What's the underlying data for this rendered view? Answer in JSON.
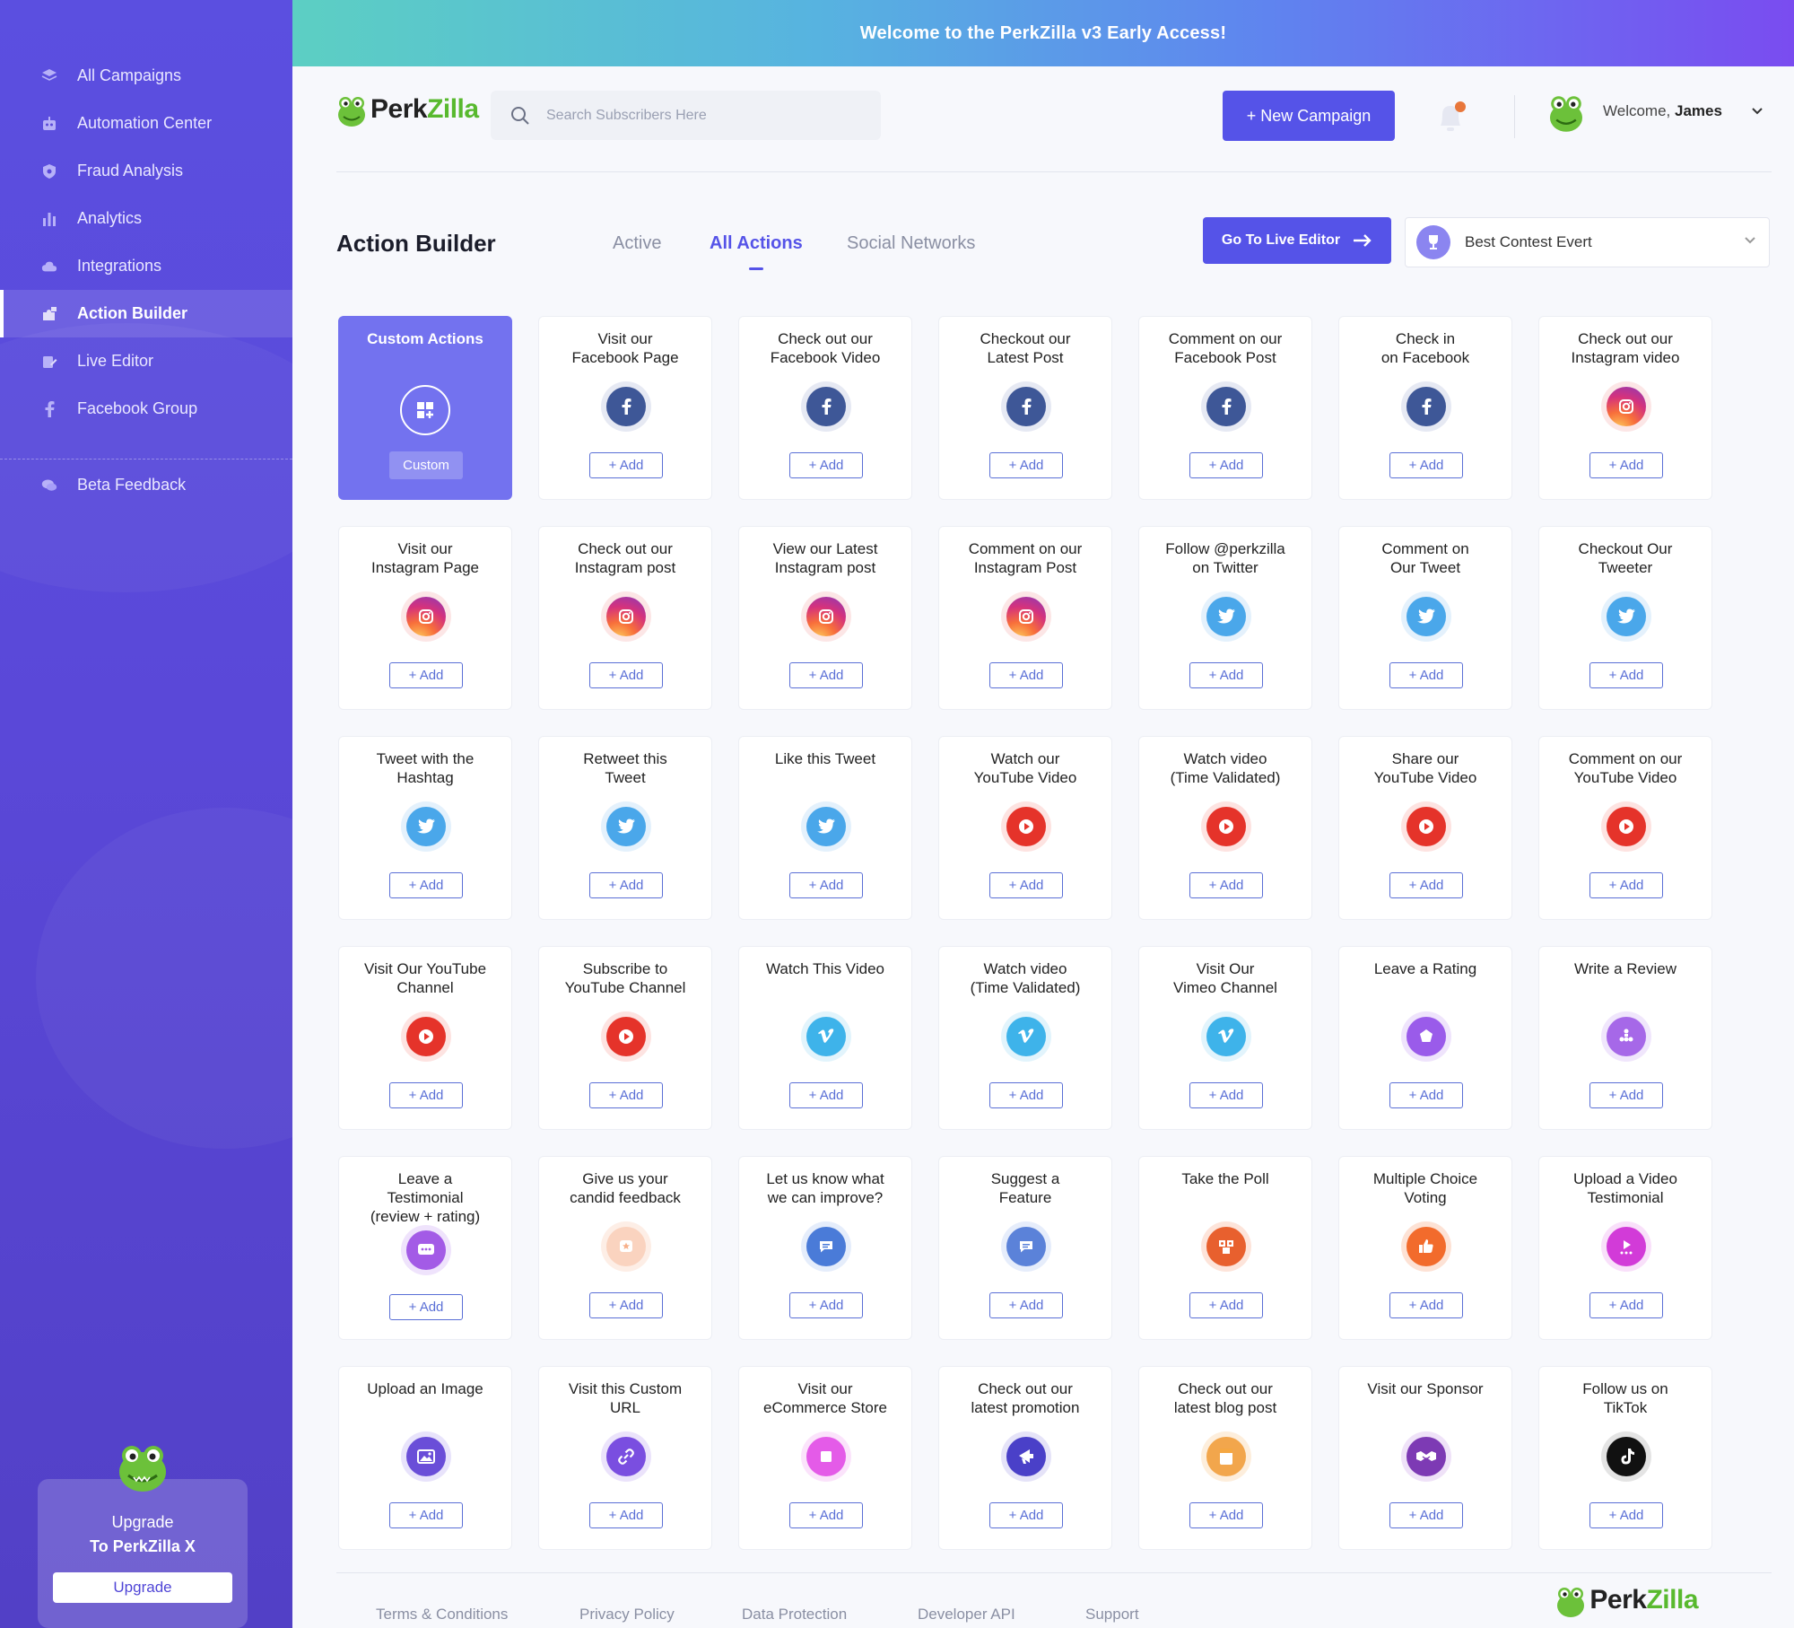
{
  "banner": {
    "text": "Welcome to the PerkZilla v3 Early Access!"
  },
  "brand": {
    "name_a": "Perk",
    "name_b": "Zilla",
    "accent": "#5553e8",
    "green": "#58b92e"
  },
  "sidebar": {
    "items": [
      {
        "label": "All Campaigns",
        "icon": "layers-icon",
        "active": false
      },
      {
        "label": "Automation Center",
        "icon": "robot-icon",
        "active": false
      },
      {
        "label": "Fraud Analysis",
        "icon": "shield-icon",
        "active": false
      },
      {
        "label": "Analytics",
        "icon": "bar-chart-icon",
        "active": false
      },
      {
        "label": "Integrations",
        "icon": "cloud-icon",
        "active": false
      },
      {
        "label": "Action Builder",
        "icon": "puzzle-icon",
        "active": true
      },
      {
        "label": "Live Editor",
        "icon": "edit-icon",
        "active": false
      },
      {
        "label": "Facebook Group",
        "icon": "facebook-icon",
        "active": false
      }
    ],
    "feedback": {
      "label": "Beta Feedback",
      "icon": "chat-icon"
    },
    "upgrade": {
      "line1": "Upgrade",
      "line2": "To PerkZilla X",
      "button": "Upgrade"
    }
  },
  "header": {
    "search_placeholder": "Search Subscribers Here",
    "new_campaign": "+ New Campaign",
    "welcome": "Welcome,",
    "user": "James"
  },
  "builder": {
    "title": "Action Builder",
    "tabs": [
      {
        "label": "Active",
        "active": false
      },
      {
        "label": "All Actions",
        "active": true
      },
      {
        "label": "Social Networks",
        "active": false
      }
    ],
    "live_editor": "Go To Live Editor",
    "contest": "Best Contest Evert"
  },
  "custom_card": {
    "title": "Custom Actions",
    "button": "Custom"
  },
  "add_label": "+ Add",
  "actions": [
    {
      "title": "Visit our\nFacebook Page",
      "icon": "facebook"
    },
    {
      "title": "Check out our\nFacebook Video",
      "icon": "facebook"
    },
    {
      "title": "Checkout our\nLatest Post",
      "icon": "facebook"
    },
    {
      "title": "Comment on our\nFacebook Post",
      "icon": "facebook"
    },
    {
      "title": "Check in\non Facebook",
      "icon": "facebook"
    },
    {
      "title": "Check out our\nInstagram video",
      "icon": "instagram"
    },
    {
      "title": "Visit our\nInstagram Page",
      "icon": "instagram"
    },
    {
      "title": "Check out our\nInstagram post",
      "icon": "instagram"
    },
    {
      "title": "View our Latest\nInstagram post",
      "icon": "instagram"
    },
    {
      "title": "Comment on our\nInstagram Post",
      "icon": "instagram"
    },
    {
      "title": "Follow @perkzilla\non Twitter",
      "icon": "twitter"
    },
    {
      "title": "Comment on\nOur Tweet",
      "icon": "twitter"
    },
    {
      "title": "Checkout Our\nTweeter",
      "icon": "twitter"
    },
    {
      "title": "Tweet with the\nHashtag",
      "icon": "twitter"
    },
    {
      "title": "Retweet this\nTweet",
      "icon": "twitter"
    },
    {
      "title": "Like this Tweet",
      "icon": "twitter"
    },
    {
      "title": "Watch our\nYouTube Video",
      "icon": "youtube"
    },
    {
      "title": "Watch video\n(Time Validated)",
      "icon": "youtube"
    },
    {
      "title": "Share our\nYouTube Video",
      "icon": "youtube"
    },
    {
      "title": "Comment on our\nYouTube Video",
      "icon": "youtube"
    },
    {
      "title": "Visit Our YouTube\nChannel",
      "icon": "youtube"
    },
    {
      "title": "Subscribe to\nYouTube Channel",
      "icon": "youtube"
    },
    {
      "title": "Watch This Video",
      "icon": "vimeo"
    },
    {
      "title": "Watch video\n(Time Validated)",
      "icon": "vimeo"
    },
    {
      "title": "Visit Our\nVimeo Channel",
      "icon": "vimeo"
    },
    {
      "title": "Leave a Rating",
      "icon": "rating"
    },
    {
      "title": "Write a Review",
      "icon": "review"
    },
    {
      "title": "Leave a\nTestimonial\n(review + rating)",
      "icon": "testimonial"
    },
    {
      "title": "Give us your\ncandid feedback",
      "icon": "feedback"
    },
    {
      "title": "Let us know what\nwe can improve?",
      "icon": "improve"
    },
    {
      "title": "Suggest a\nFeature",
      "icon": "feature"
    },
    {
      "title": "Take the Poll",
      "icon": "poll"
    },
    {
      "title": "Multiple Choice\nVoting",
      "icon": "voting"
    },
    {
      "title": "Upload a Video\nTestimonial",
      "icon": "video-testimonial"
    },
    {
      "title": "Upload an Image",
      "icon": "image"
    },
    {
      "title": "Visit this Custom\nURL",
      "icon": "link"
    },
    {
      "title": "Visit our\neCommerce Store",
      "icon": "store"
    },
    {
      "title": "Check out our\nlatest promotion",
      "icon": "promotion"
    },
    {
      "title": "Check out our\nlatest blog post",
      "icon": "blog"
    },
    {
      "title": "Visit our Sponsor",
      "icon": "sponsor"
    },
    {
      "title": "Follow us on\nTikTok",
      "icon": "tiktok"
    }
  ],
  "footer": {
    "links": [
      "Terms & Conditions",
      "Privacy Policy",
      "Data Protection",
      "Developer API",
      "Support"
    ]
  }
}
